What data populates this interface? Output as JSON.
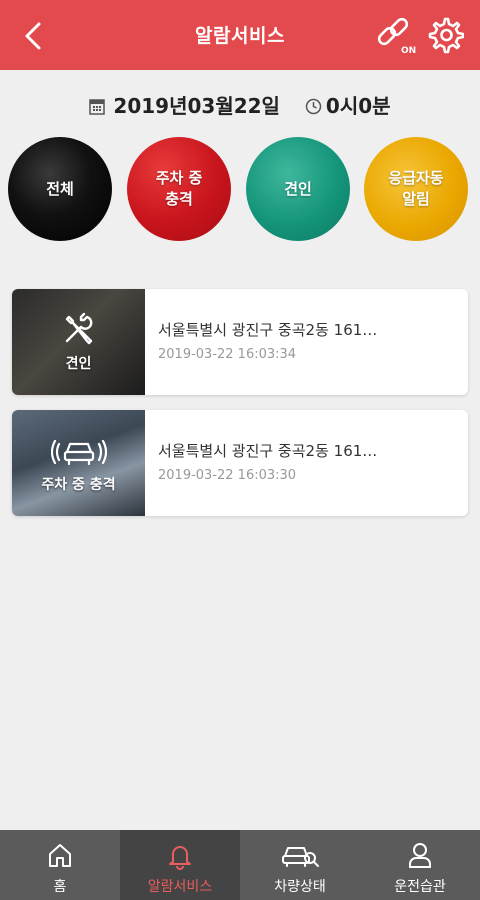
{
  "header": {
    "title": "알람서비스",
    "link_badge": "ON"
  },
  "datetime": {
    "date": "2019년03월22일",
    "time": "0시0분"
  },
  "filters": [
    {
      "label": "전체"
    },
    {
      "label": "주차 중\n충격"
    },
    {
      "label": "견인"
    },
    {
      "label": "응급자동\n알림"
    }
  ],
  "alerts": [
    {
      "type": "견인",
      "address": "서울특별시 광진구 중곡2동 161…",
      "time": "2019-03-22 16:03:34"
    },
    {
      "type": "주차 중 충격",
      "address": "서울특별시 광진구 중곡2동 161…",
      "time": "2019-03-22 16:03:30"
    }
  ],
  "tabs": [
    {
      "label": "홈"
    },
    {
      "label": "알람서비스"
    },
    {
      "label": "차량상태"
    },
    {
      "label": "운전습관"
    }
  ],
  "colors": {
    "header": "#e24a4e",
    "active_tab": "#e95d5d"
  }
}
